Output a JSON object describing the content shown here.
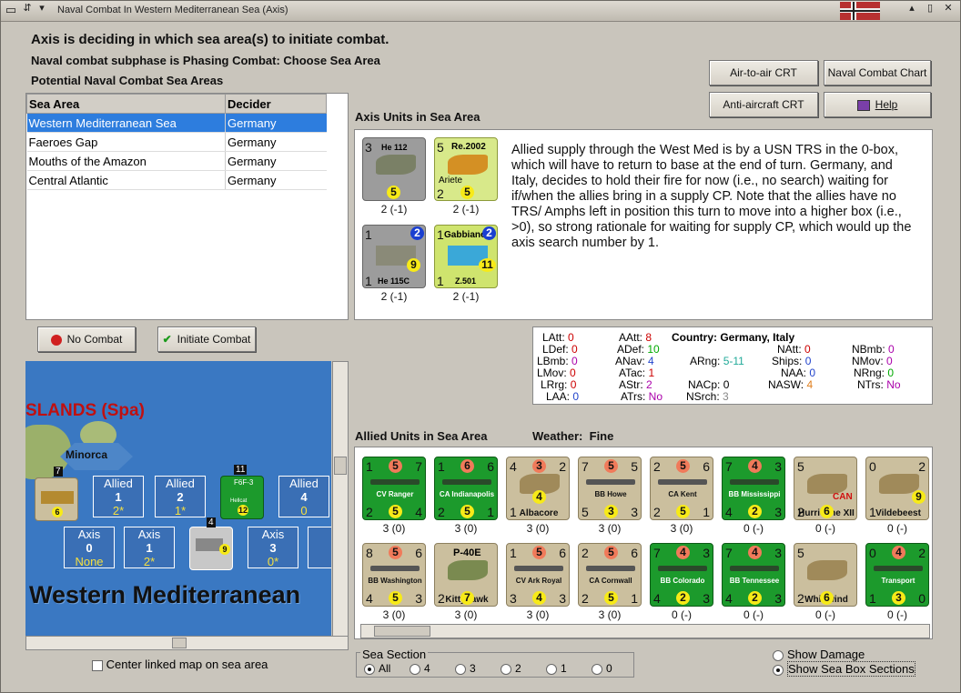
{
  "window": {
    "title": "Naval Combat In Western Mediterranean Sea (Axis)"
  },
  "header": {
    "line1": "Axis is deciding in which sea area(s) to initiate combat.",
    "line2": "Naval combat subphase is Phasing Combat: Choose Sea Area",
    "line3": "Potential Naval Combat Sea Areas"
  },
  "buttons": {
    "air_to_air": "Air-to-air CRT",
    "naval_chart": "Naval Combat Chart",
    "anti_aircraft": "Anti-aircraft CRT",
    "help": "Help",
    "no_combat": "No Combat",
    "initiate_combat": "Initiate Combat"
  },
  "sea_table": {
    "headers": [
      "Sea Area",
      "Decider"
    ],
    "rows": [
      {
        "area": "Western Mediterranean Sea",
        "decider": "Germany"
      },
      {
        "area": "Faeroes Gap",
        "decider": "Germany"
      },
      {
        "area": "Mouths of the Amazon",
        "decider": "Germany"
      },
      {
        "area": "Central Atlantic",
        "decider": "Germany"
      }
    ]
  },
  "axis_units": {
    "title": "Axis Units in Sea Area",
    "units": [
      {
        "name": "He 112",
        "tl": "3",
        "bottom": "5",
        "below": "2 (-1)"
      },
      {
        "name": "Re.2002",
        "sub": "Ariete",
        "tl": "5",
        "bottom": "2",
        "bottom2": "5",
        "below": "2 (-1)"
      },
      {
        "name": "He 115C",
        "tl": "1",
        "tr": "2",
        "bottom": "9",
        "bl": "1",
        "below": "2 (-1)"
      },
      {
        "name": "Gabbiano",
        "sub": "Z.501",
        "tl": "1",
        "tr": "2",
        "bottom": "11",
        "bl": "1",
        "below": "2 (-1)"
      }
    ]
  },
  "note": "Allied supply through the West Med is by a USN TRS in the 0-box, which will have to return to base at the end of turn.  Germany, and Italy, decides to hold their fire for now (i.e., no search) waiting for if/when the allies bring in a supply CP.  Note that the allies have no TRS/ Amphs left in position this turn to move into a higher box (i.e., >0), so strong rationale for waiting for supply CP, which would up the axis search number by 1.",
  "stats": {
    "country_label": "Country:",
    "country_value": "Germany, Italy",
    "items": [
      {
        "k": "LAtt:",
        "v": "0"
      },
      {
        "k": "LDef:",
        "v": "0"
      },
      {
        "k": "LBmb:",
        "v": "0"
      },
      {
        "k": "LMov:",
        "v": "0"
      },
      {
        "k": "LRrg:",
        "v": "0"
      },
      {
        "k": "LAA:",
        "v": "0"
      },
      {
        "k": "AAtt:",
        "v": "8"
      },
      {
        "k": "ADef:",
        "v": "10"
      },
      {
        "k": "ANav:",
        "v": "4"
      },
      {
        "k": "ATac:",
        "v": "1"
      },
      {
        "k": "AStr:",
        "v": "2"
      },
      {
        "k": "ATrs:",
        "v": "No"
      },
      {
        "k": "ARng:",
        "v": "5-11"
      },
      {
        "k": "NACp:",
        "v": "0"
      },
      {
        "k": "NSrch:",
        "v": "3"
      },
      {
        "k": "NAtt:",
        "v": "0"
      },
      {
        "k": "Ships:",
        "v": "0"
      },
      {
        "k": "NAA:",
        "v": "0"
      },
      {
        "k": "NASW:",
        "v": "4"
      },
      {
        "k": "NBmb:",
        "v": "0"
      },
      {
        "k": "NMov:",
        "v": "0"
      },
      {
        "k": "NRng:",
        "v": "0"
      },
      {
        "k": "NTrs:",
        "v": "No"
      }
    ]
  },
  "allied": {
    "title": "Allied Units in Sea Area",
    "weather_label": "Weather:",
    "weather_value": "Fine",
    "row1": [
      {
        "name": "CV Ranger",
        "a": "1",
        "b": "5",
        "c": "7",
        "d": "2",
        "e": "5",
        "f": "4",
        "below": "3 (0)"
      },
      {
        "name": "CA Indianapolis",
        "a": "1",
        "b": "6",
        "c": "6",
        "d": "2",
        "e": "5",
        "f": "1",
        "below": "3 (0)"
      },
      {
        "name": "Albacore",
        "a": "4",
        "b": "3",
        "c": "2",
        "d": "1",
        "e": "4",
        "f": "",
        "below": "3 (0)"
      },
      {
        "name": "BB Howe",
        "a": "7",
        "b": "5",
        "c": "5",
        "d": "5",
        "e": "3",
        "f": "3",
        "below": "3 (0)"
      },
      {
        "name": "CA Kent",
        "a": "2",
        "b": "5",
        "c": "6",
        "d": "2",
        "e": "5",
        "f": "1",
        "below": "3 (0)"
      },
      {
        "name": "BB Mississippi",
        "a": "7",
        "b": "4",
        "c": "3",
        "d": "4",
        "e": "2",
        "f": "3",
        "below": "0 (-)"
      },
      {
        "name": "Hurricane XII",
        "sub": "CAN",
        "a": "5",
        "b": "",
        "c": "",
        "d": "2",
        "e": "6",
        "f": "",
        "below": "0 (-)"
      },
      {
        "name": "Vildebeest",
        "a": "0",
        "b": "",
        "c": "2",
        "d": "1",
        "e": "9",
        "f": "",
        "below": "0 (-)"
      }
    ],
    "row2": [
      {
        "name": "BB Washington",
        "a": "8",
        "b": "5",
        "c": "6",
        "d": "4",
        "e": "5",
        "f": "3",
        "below": "3 (0)"
      },
      {
        "name": "Kittyhawk",
        "top": "P-40E",
        "a": "",
        "b": "",
        "c": "",
        "d": "2",
        "e": "7",
        "f": "",
        "below": "3 (0)"
      },
      {
        "name": "CV Ark Royal",
        "a": "1",
        "b": "5",
        "c": "6",
        "d": "3",
        "e": "4",
        "f": "3",
        "below": "3 (0)"
      },
      {
        "name": "CA Cornwall",
        "a": "2",
        "b": "5",
        "c": "6",
        "d": "2",
        "e": "5",
        "f": "1",
        "below": "3 (0)"
      },
      {
        "name": "BB Colorado",
        "a": "7",
        "b": "4",
        "c": "3",
        "d": "4",
        "e": "2",
        "f": "3",
        "below": "0 (-)"
      },
      {
        "name": "BB Tennessee",
        "a": "7",
        "b": "4",
        "c": "3",
        "d": "4",
        "e": "2",
        "f": "3",
        "below": "0 (-)"
      },
      {
        "name": "Whirlwind",
        "a": "5",
        "b": "",
        "c": "",
        "d": "2",
        "e": "6",
        "f": "",
        "below": "0 (-)"
      },
      {
        "name": "Transport",
        "a": "0",
        "b": "4",
        "c": "2",
        "d": "1",
        "e": "3",
        "f": "0",
        "below": "0 (-)"
      }
    ]
  },
  "map": {
    "islands_label": "SLANDS (Spa)",
    "minorca": "Minorca",
    "area_name": "Western Mediterranean",
    "hellcat": "F6F-3",
    "hellcat_sub": "Hellcat",
    "hellcat_count": "11",
    "hurricane_count": "7",
    "he115_count": "4",
    "boxes_allied": [
      {
        "t": "Allied",
        "n": "1",
        "s": "2*"
      },
      {
        "t": "Allied",
        "n": "2",
        "s": "1*"
      },
      {
        "t": "Allied",
        "n": "4",
        "s": "0"
      }
    ],
    "boxes_axis": [
      {
        "t": "Axis",
        "n": "0",
        "s": "None"
      },
      {
        "t": "Axis",
        "n": "1",
        "s": "2*"
      },
      {
        "t": "Axis",
        "n": "3",
        "s": "0*"
      }
    ]
  },
  "center_map_label": "Center linked map on sea area",
  "sea_section": {
    "label": "Sea Section",
    "options": [
      "All",
      "4",
      "3",
      "2",
      "1",
      "0"
    ]
  },
  "options": {
    "show_damage": "Show Damage",
    "show_sections": "Show Sea Box Sections"
  }
}
